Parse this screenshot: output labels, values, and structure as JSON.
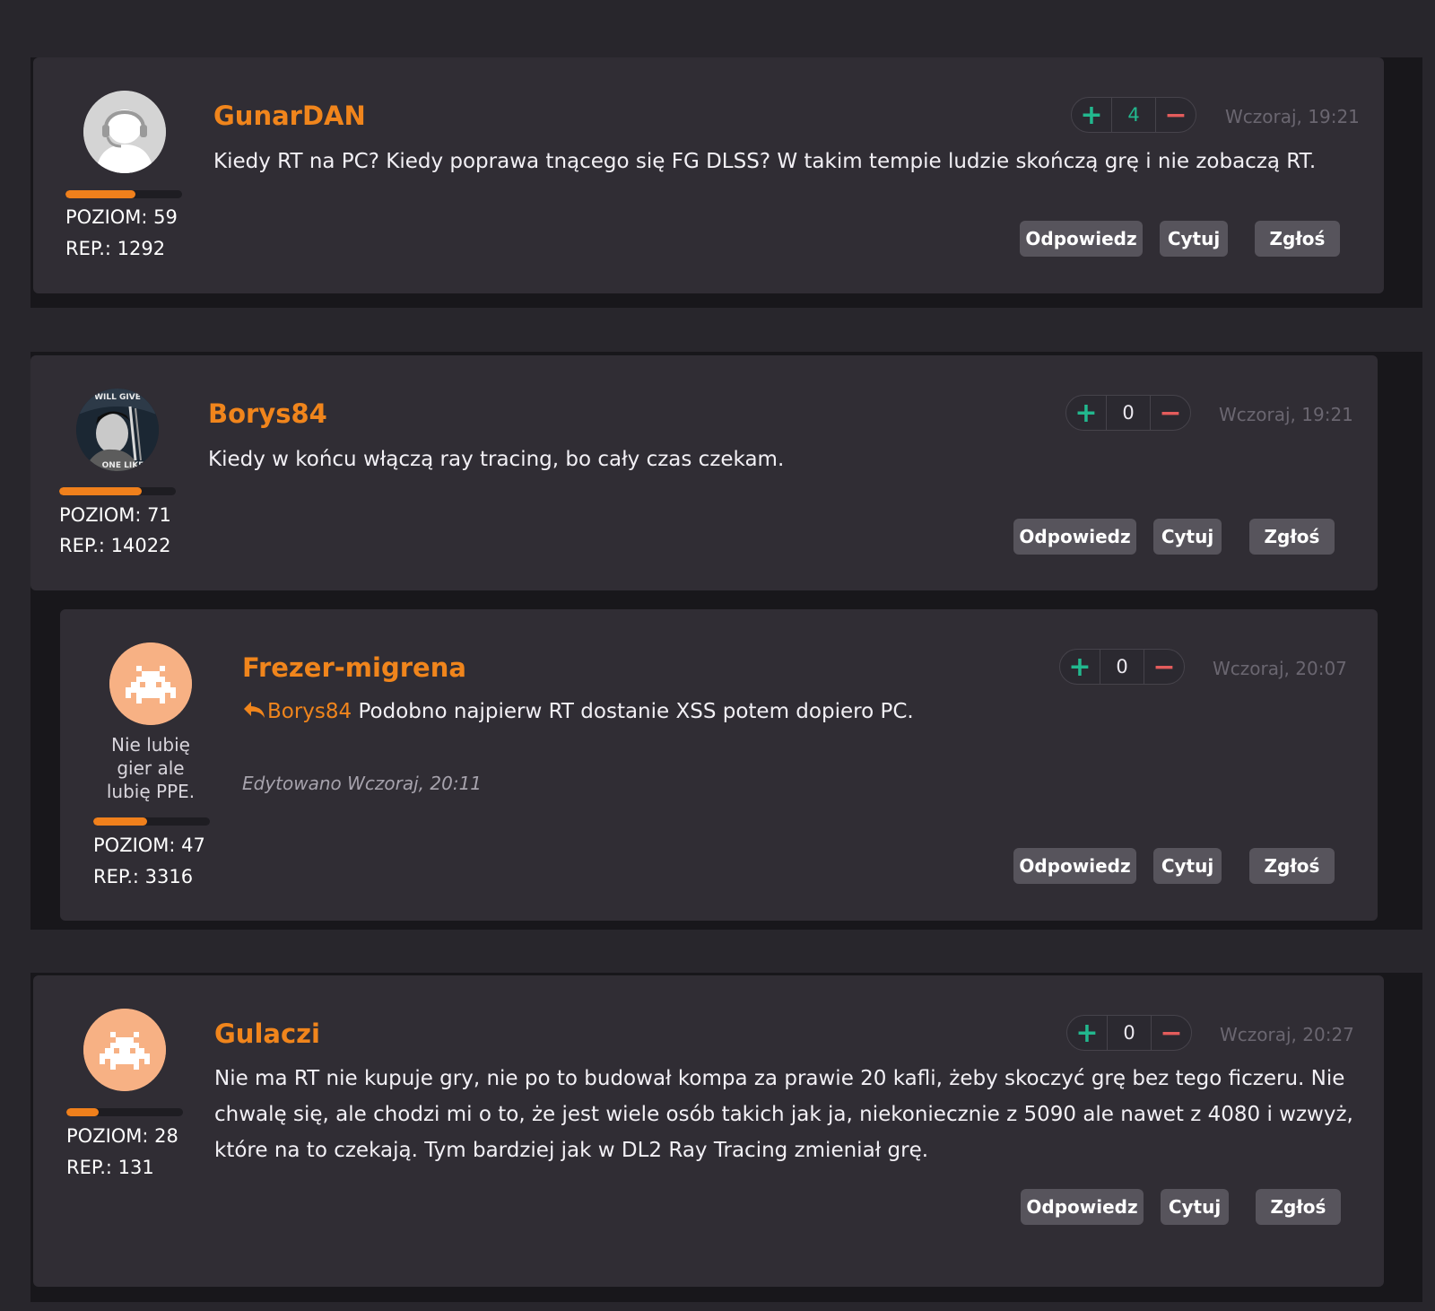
{
  "posts": [
    {
      "author": "GunarDAN",
      "text": "Kiedy RT na PC? Kiedy poprawa tnącego się FG DLSS? W takim tempie ludzie skończą grę i nie zobaczą RT.",
      "votes": "4",
      "date": "Wczoraj, 19:21",
      "level": "POZIOM: 59",
      "rep": "REP.: 1292",
      "level_progress": 0.6,
      "avatar": "headset-default-avatar"
    },
    {
      "author": "Borys84",
      "text": "Kiedy w końcu włączą ray tracing, bo cały czas czekam.",
      "votes": "0",
      "date": "Wczoraj, 19:21",
      "level": "POZIOM: 71",
      "rep": "REP.: 14022",
      "level_progress": 0.71,
      "avatar": "photo-avatar"
    },
    {
      "author": "Frezer-migrena",
      "reply_to": "Borys84",
      "text": "Podobno najpierw RT dostanie XSS potem dopiero PC.",
      "edited": "Edytowano Wczoraj, 20:11",
      "signature": "Nie lubię gier ale lubię PPE.",
      "votes": "0",
      "date": "Wczoraj, 20:07",
      "level": "POZIOM: 47",
      "rep": "REP.: 3316",
      "level_progress": 0.46,
      "avatar": "space-invader-avatar"
    },
    {
      "author": "Gulaczi",
      "text": "Nie ma RT nie kupuje gry, nie po to budował kompa za prawie 20 kafli, żeby skoczyć grę bez tego ficzeru. Nie chwalę się, ale chodzi mi o to, że jest wiele osób takich jak ja, niekoniecznie z 5090 ale nawet z 4080 i wzwyż, które na to czekają. Tym bardziej jak w DL2 Ray Tracing zmieniał grę.",
      "votes": "0",
      "date": "Wczoraj, 20:27",
      "level": "POZIOM: 28",
      "rep": "REP.: 131",
      "level_progress": 0.28,
      "avatar": "space-invader-avatar"
    }
  ],
  "buttons": {
    "reply": "Odpowiedz",
    "quote": "Cytuj",
    "report": "Zgłoś"
  },
  "vote_icons": {
    "plus": "+",
    "minus": "−"
  },
  "colors": {
    "author": "#f0851c",
    "upvote": "#22b88e",
    "downvote": "#e45c5c",
    "level_bar": "#f0801c"
  }
}
